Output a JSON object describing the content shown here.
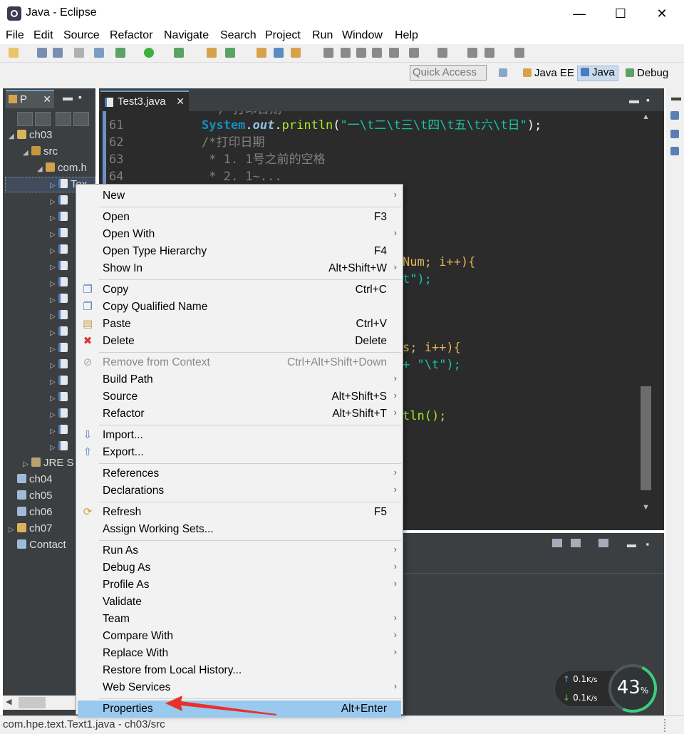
{
  "window": {
    "title": "Java - Eclipse",
    "controls": {
      "minimize": "—",
      "maximize": "☐",
      "close": "✕"
    }
  },
  "menubar": [
    "File",
    "Edit",
    "Source",
    "Refactor",
    "Navigate",
    "Search",
    "Project",
    "Run",
    "Window",
    "Help"
  ],
  "perspective_bar": {
    "quick_access_placeholder": "Quick Access",
    "perspectives": [
      "Java EE",
      "Java",
      "Debug"
    ],
    "active": "Java"
  },
  "explorer": {
    "tab_label": "P",
    "close": "✕",
    "tree": [
      {
        "label": "ch03",
        "icon": "project-icon",
        "arrow": "◢",
        "indent": 1
      },
      {
        "label": "src",
        "icon": "source-folder-icon",
        "arrow": "◢",
        "indent": 2
      },
      {
        "label": "com.h",
        "icon": "package-icon",
        "arrow": "◢",
        "indent": 3
      },
      {
        "label": "Tex",
        "icon": "java-file-icon",
        "arrow": "▷",
        "indent": 4,
        "selected": true
      },
      {
        "label": "",
        "icon": "java-file-icon",
        "arrow": "▷",
        "indent": 4
      },
      {
        "label": "",
        "icon": "java-file-icon",
        "arrow": "▷",
        "indent": 4
      },
      {
        "label": "",
        "icon": "java-file-icon",
        "arrow": "▷",
        "indent": 4
      },
      {
        "label": "",
        "icon": "java-file-icon",
        "arrow": "▷",
        "indent": 4
      },
      {
        "label": "",
        "icon": "java-file-icon",
        "arrow": "▷",
        "indent": 4
      },
      {
        "label": "",
        "icon": "java-file-icon",
        "arrow": "▷",
        "indent": 4
      },
      {
        "label": "",
        "icon": "java-file-icon",
        "arrow": "▷",
        "indent": 4
      },
      {
        "label": "",
        "icon": "java-file-icon",
        "arrow": "▷",
        "indent": 4
      },
      {
        "label": "",
        "icon": "java-file-icon",
        "arrow": "▷",
        "indent": 4
      },
      {
        "label": "",
        "icon": "java-file-icon",
        "arrow": "▷",
        "indent": 4
      },
      {
        "label": "",
        "icon": "java-file-icon",
        "arrow": "▷",
        "indent": 4
      },
      {
        "label": "",
        "icon": "java-file-icon",
        "arrow": "▷",
        "indent": 4
      },
      {
        "label": "",
        "icon": "java-file-icon",
        "arrow": "▷",
        "indent": 4
      },
      {
        "label": "",
        "icon": "java-file-icon",
        "arrow": "▷",
        "indent": 4
      },
      {
        "label": "",
        "icon": "java-file-icon",
        "arrow": "▷",
        "indent": 4
      },
      {
        "label": "",
        "icon": "java-file-icon",
        "arrow": "▷",
        "indent": 4
      },
      {
        "label": "JRE S",
        "icon": "library-icon",
        "arrow": "▷",
        "indent": 2
      },
      {
        "label": "ch04",
        "icon": "folder-icon",
        "arrow": "",
        "indent": 1
      },
      {
        "label": "ch05",
        "icon": "folder-icon",
        "arrow": "",
        "indent": 1
      },
      {
        "label": "ch06",
        "icon": "folder-icon",
        "arrow": "",
        "indent": 1
      },
      {
        "label": "ch07",
        "icon": "project-icon",
        "arrow": "▷",
        "indent": 1
      },
      {
        "label": "Contact",
        "icon": "folder-icon",
        "arrow": "",
        "indent": 1
      }
    ]
  },
  "editor": {
    "tab_label": "Test3.java",
    "close": "✕",
    "lines": [
      {
        "n": "61",
        "code": "System.out.println(\"一\\t二\\t三\\t四\\t五\\t六\\t日\");"
      },
      {
        "n": "62",
        "code": "/*打印日期"
      },
      {
        "n": "63",
        "code": " * 1. 1号之前的空格"
      },
      {
        "n": "64",
        "code": " * 2. 1~..."
      }
    ],
    "partial_fragments": [
      "Num; i++){",
      "t\");",
      "s; i++){",
      "+ \"\\t\");",
      "tln();"
    ]
  },
  "context_menu": {
    "items": [
      {
        "label": "New",
        "shortcut": "",
        "submenu": true
      },
      {
        "label": "Open",
        "shortcut": "F3"
      },
      {
        "label": "Open With",
        "shortcut": "",
        "submenu": true
      },
      {
        "label": "Open Type Hierarchy",
        "shortcut": "F4"
      },
      {
        "label": "Show In",
        "shortcut": "Alt+Shift+W",
        "submenu": true
      },
      {
        "label": "Copy",
        "shortcut": "Ctrl+C",
        "icon": "copy-icon"
      },
      {
        "label": "Copy Qualified Name",
        "shortcut": "",
        "icon": "copy-qualified-icon"
      },
      {
        "label": "Paste",
        "shortcut": "Ctrl+V",
        "icon": "paste-icon"
      },
      {
        "label": "Delete",
        "shortcut": "Delete",
        "icon": "delete-icon"
      },
      {
        "label": "Remove from Context",
        "shortcut": "Ctrl+Alt+Shift+Down",
        "disabled": true,
        "icon": "remove-context-icon"
      },
      {
        "label": "Build Path",
        "shortcut": "",
        "submenu": true
      },
      {
        "label": "Source",
        "shortcut": "Alt+Shift+S",
        "submenu": true
      },
      {
        "label": "Refactor",
        "shortcut": "Alt+Shift+T",
        "submenu": true
      },
      {
        "label": "Import...",
        "shortcut": "",
        "icon": "import-icon"
      },
      {
        "label": "Export...",
        "shortcut": "",
        "icon": "export-icon"
      },
      {
        "label": "References",
        "shortcut": "",
        "submenu": true
      },
      {
        "label": "Declarations",
        "shortcut": "",
        "submenu": true
      },
      {
        "label": "Refresh",
        "shortcut": "F5",
        "icon": "refresh-icon"
      },
      {
        "label": "Assign Working Sets...",
        "shortcut": ""
      },
      {
        "label": "Run As",
        "shortcut": "",
        "submenu": true
      },
      {
        "label": "Debug As",
        "shortcut": "",
        "submenu": true
      },
      {
        "label": "Profile As",
        "shortcut": "",
        "submenu": true
      },
      {
        "label": "Validate",
        "shortcut": ""
      },
      {
        "label": "Team",
        "shortcut": "",
        "submenu": true
      },
      {
        "label": "Compare With",
        "shortcut": "",
        "submenu": true
      },
      {
        "label": "Replace With",
        "shortcut": "",
        "submenu": true
      },
      {
        "label": "Restore from Local History...",
        "shortcut": ""
      },
      {
        "label": "Web Services",
        "shortcut": "",
        "submenu": true
      },
      {
        "label": "Properties",
        "shortcut": "Alt+Enter",
        "selected": true
      }
    ],
    "submenu_arrow": "›"
  },
  "network_widget": {
    "upload": "0.1",
    "download": "0.1",
    "unit": "K/s",
    "gauge_value": "43",
    "gauge_unit": "%"
  },
  "statusbar": {
    "text": "com.hpe.text.Text1.java - ch03/src"
  },
  "colors": {
    "dark_panel": "#3c3f41",
    "editor_bg": "#2b2b2b",
    "menu_selection": "#99c9ef",
    "annotation_arrow": "#e8312a"
  }
}
